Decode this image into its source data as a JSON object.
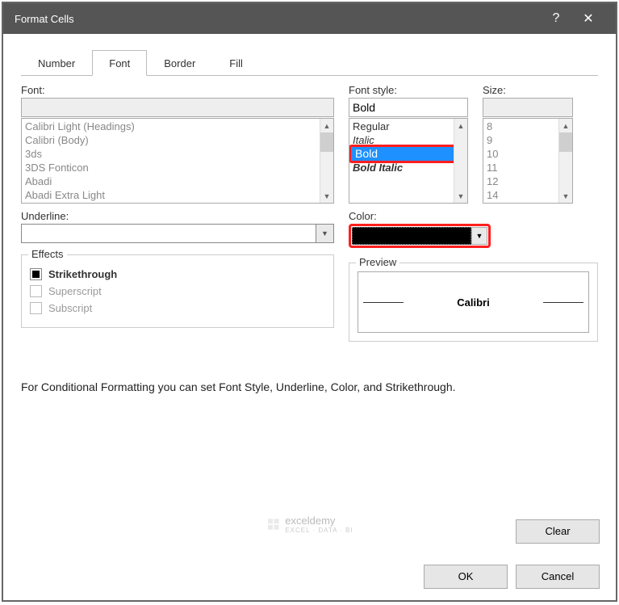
{
  "title": "Format Cells",
  "tabs": [
    {
      "label": "Number"
    },
    {
      "label": "Font",
      "active": true
    },
    {
      "label": "Border"
    },
    {
      "label": "Fill"
    }
  ],
  "font": {
    "label": "Font:",
    "value": "",
    "items": [
      "Calibri Light (Headings)",
      "Calibri (Body)",
      "3ds",
      "3DS Fonticon",
      "Abadi",
      "Abadi Extra Light"
    ]
  },
  "fontStyle": {
    "label": "Font style:",
    "value": "Bold",
    "items": [
      "Regular",
      "Italic",
      "Bold",
      "Bold Italic"
    ],
    "selectedIndex": 2
  },
  "size": {
    "label": "Size:",
    "value": "",
    "items": [
      "8",
      "9",
      "10",
      "11",
      "12",
      "14"
    ]
  },
  "underline": {
    "label": "Underline:"
  },
  "color": {
    "label": "Color:"
  },
  "effects": {
    "legend": "Effects",
    "strikethrough": {
      "label": "Strikethrough",
      "checked": true,
      "enabled": true
    },
    "superscript": {
      "label": "Superscript",
      "checked": false,
      "enabled": false
    },
    "subscript": {
      "label": "Subscript",
      "checked": false,
      "enabled": false
    }
  },
  "preview": {
    "legend": "Preview",
    "text": "Calibri"
  },
  "hint": "For Conditional Formatting you can set Font Style, Underline, Color, and Strikethrough.",
  "buttons": {
    "clear": "Clear",
    "ok": "OK",
    "cancel": "Cancel"
  },
  "watermark": {
    "brand": "exceldemy",
    "tagline": "EXCEL · DATA · BI"
  }
}
